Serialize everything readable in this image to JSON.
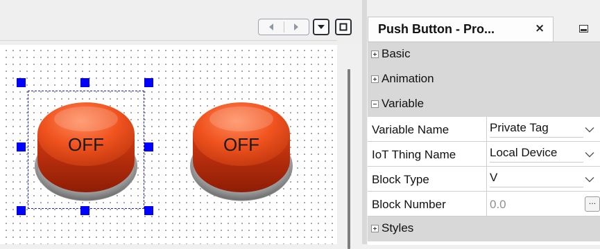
{
  "colors": {
    "selection_handle": "#0000ff",
    "button_face": "#e84b1f",
    "panel_category_bg": "#d8d8d8"
  },
  "canvas": {
    "toolbar": {
      "nav_prev_icon": "triangle-left-icon",
      "nav_next_icon": "triangle-right-icon",
      "dropdown_icon": "triangle-down-icon",
      "restore_icon": "square-icon"
    },
    "buttons": [
      {
        "label": "OFF",
        "selected": true
      },
      {
        "label": "OFF",
        "selected": false
      }
    ]
  },
  "properties": {
    "tab_title": "Push Button - Pro...",
    "tab_close": "×",
    "categories": {
      "basic": "Basic",
      "animation": "Animation",
      "variable": "Variable",
      "styles": "Styles"
    },
    "rows": [
      {
        "name": "Variable Name",
        "value": "Private Tag",
        "control": "dropdown"
      },
      {
        "name": "IoT Thing Name",
        "value": "Local Device",
        "control": "dropdown"
      },
      {
        "name": "Block Type",
        "value": "V",
        "control": "dropdown"
      },
      {
        "name": "Block Number",
        "value": "0.0",
        "control": "ellipsis",
        "ellipsis_label": "..."
      }
    ]
  }
}
